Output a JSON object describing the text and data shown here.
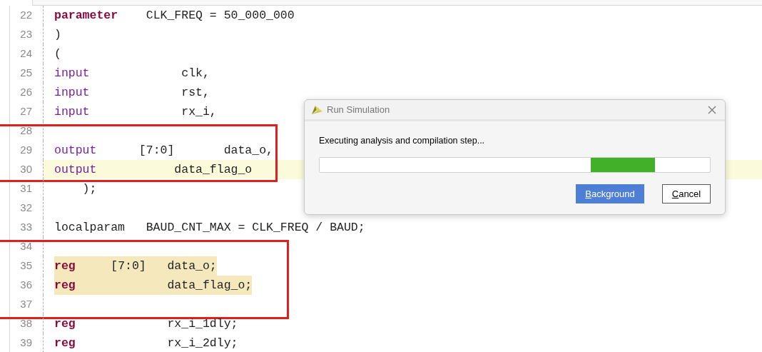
{
  "editor": {
    "blocks": [
      {
        "boxed": false,
        "lines": [
          {
            "number": "22",
            "current_line": false,
            "highlighted": false,
            "tokens": [
              {
                "text": "parameter",
                "kind": "keyword"
              },
              {
                "text": "    CLK_FREQ = 50_000_000",
                "kind": "plain"
              }
            ]
          },
          {
            "number": "23",
            "current_line": false,
            "highlighted": false,
            "tokens": [
              {
                "text": ")",
                "kind": "plain"
              }
            ]
          },
          {
            "number": "24",
            "current_line": false,
            "highlighted": false,
            "tokens": [
              {
                "text": "(",
                "kind": "plain"
              }
            ]
          },
          {
            "number": "25",
            "current_line": false,
            "highlighted": false,
            "tokens": [
              {
                "text": "input",
                "kind": "port"
              },
              {
                "text": "             clk,",
                "kind": "plain"
              }
            ]
          },
          {
            "number": "26",
            "current_line": false,
            "highlighted": false,
            "tokens": [
              {
                "text": "input",
                "kind": "port"
              },
              {
                "text": "             rst,",
                "kind": "plain"
              }
            ]
          },
          {
            "number": "27",
            "current_line": false,
            "highlighted": false,
            "tokens": [
              {
                "text": "input",
                "kind": "port"
              },
              {
                "text": "             rx_i,",
                "kind": "plain"
              }
            ]
          }
        ]
      },
      {
        "boxed": true,
        "lines": [
          {
            "number": "28",
            "current_line": false,
            "highlighted": false
          },
          {
            "number": "29",
            "current_line": false,
            "highlighted": false,
            "tokens": [
              {
                "text": "output",
                "kind": "port"
              },
              {
                "text": "      [7:0]       data_o,",
                "kind": "plain"
              }
            ]
          },
          {
            "number": "30",
            "current_line": true,
            "highlighted": false,
            "tokens": [
              {
                "text": "output",
                "kind": "port"
              },
              {
                "text": "           data_flag_o",
                "kind": "plain"
              }
            ]
          }
        ]
      },
      {
        "boxed": false,
        "lines": [
          {
            "number": "31",
            "current_line": false,
            "highlighted": false,
            "tokens": [
              {
                "text": "    );",
                "kind": "plain"
              }
            ]
          },
          {
            "number": "32",
            "current_line": false,
            "highlighted": false
          },
          {
            "number": "33",
            "current_line": false,
            "highlighted": false,
            "tokens": [
              {
                "text": "localparam   BAUD_CNT_MAX = CLK_FREQ / BAUD;",
                "kind": "plain"
              }
            ]
          }
        ]
      },
      {
        "boxed": true,
        "lines": [
          {
            "number": "34",
            "current_line": false,
            "highlighted": false
          },
          {
            "number": "35",
            "current_line": false,
            "highlighted": true,
            "tokens": [
              {
                "text": "reg",
                "kind": "keyword"
              },
              {
                "text": "     [7:0]   data_o;",
                "kind": "plain"
              }
            ]
          },
          {
            "number": "36",
            "current_line": false,
            "highlighted": true,
            "tokens": [
              {
                "text": "reg",
                "kind": "keyword"
              },
              {
                "text": "             data_flag_o;",
                "kind": "plain"
              }
            ]
          },
          {
            "number": "37",
            "current_line": false,
            "highlighted": false
          }
        ]
      },
      {
        "boxed": false,
        "lines": [
          {
            "number": "38",
            "current_line": false,
            "highlighted": false,
            "tokens": [
              {
                "text": "reg",
                "kind": "keyword"
              },
              {
                "text": "             rx_i_1dly;",
                "kind": "plain"
              }
            ]
          },
          {
            "number": "39",
            "current_line": false,
            "highlighted": false,
            "tokens": [
              {
                "text": "reg",
                "kind": "keyword"
              },
              {
                "text": "             rx_i_2dly;",
                "kind": "plain"
              }
            ]
          }
        ]
      }
    ]
  },
  "dialog": {
    "title": "Run Simulation",
    "message": "Executing analysis and compilation step...",
    "progress": {
      "indeterminate": true
    },
    "buttons": [
      {
        "label": "Background",
        "primary": true,
        "underline_first": true
      },
      {
        "label": "Cancel",
        "primary": false,
        "underline_first": true
      }
    ]
  }
}
